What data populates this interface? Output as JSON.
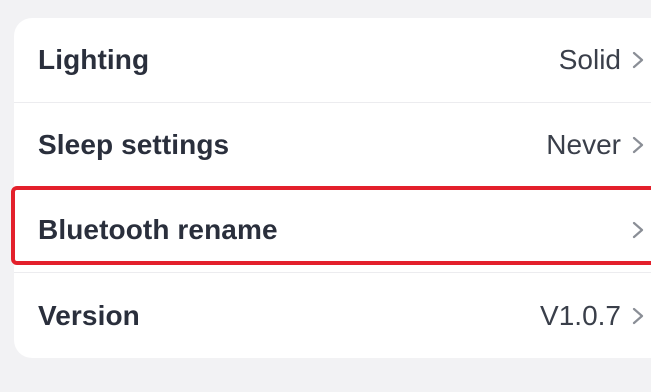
{
  "settings": {
    "rows": [
      {
        "label": "Lighting",
        "value": "Solid",
        "icon": "chevron-right-icon"
      },
      {
        "label": "Sleep settings",
        "value": "Never",
        "icon": "chevron-right-icon"
      },
      {
        "label": "Bluetooth rename",
        "value": "",
        "icon": "chevron-right-icon"
      },
      {
        "label": "Version",
        "value": "V1.0.7",
        "icon": "chevron-right-icon"
      }
    ]
  },
  "highlight": {
    "target": "Bluetooth rename",
    "color": "#e3202b"
  },
  "colors": {
    "background": "#f2f2f4",
    "card": "#ffffff",
    "label_text": "#2a2f3c",
    "value_text": "#3a3f4a",
    "chevron": "#8a8e96"
  }
}
